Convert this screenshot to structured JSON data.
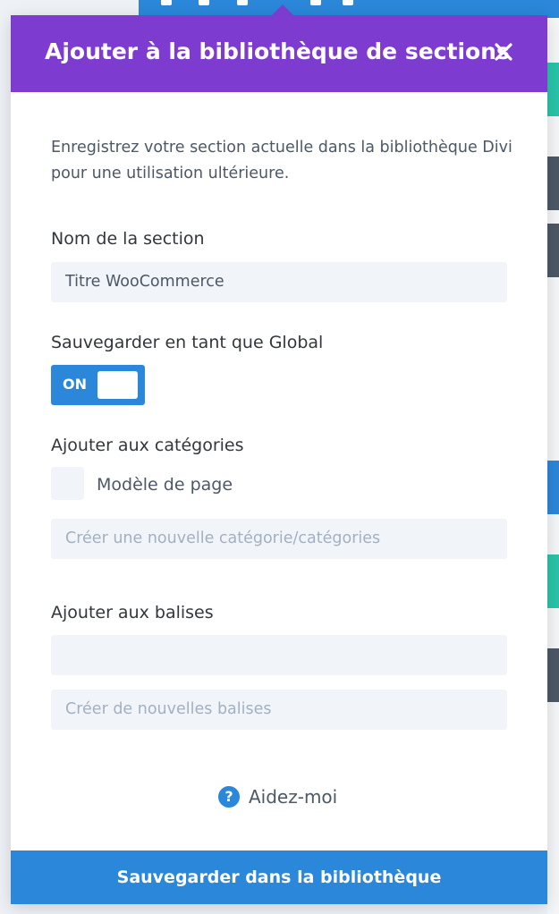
{
  "modal": {
    "title": "Ajouter à la bibliothèque de sections",
    "description": "Enregistrez votre section actuelle dans la bibliothèque Divi pour une utilisation ultérieure."
  },
  "section_name": {
    "label": "Nom de la section",
    "value": "Titre WooCommerce"
  },
  "global": {
    "label": "Sauvegarder en tant que Global",
    "toggle_text": "ON",
    "toggle_state": true
  },
  "categories": {
    "label": "Ajouter aux catégories",
    "options": [
      {
        "label": "Modèle de page",
        "checked": false
      }
    ],
    "new_placeholder": "Créer une nouvelle catégorie/catégories"
  },
  "tags": {
    "label": "Ajouter aux balises",
    "value": "",
    "new_placeholder": "Créer de nouvelles balises"
  },
  "help": {
    "icon": "question-circle-icon",
    "label": "Aidez-moi"
  },
  "footer": {
    "save_label": "Sauvegarder dans la bibliothèque"
  },
  "colors": {
    "header": "#7e3bd0",
    "accent": "#2b87da",
    "field_bg": "#f1f5f9"
  }
}
